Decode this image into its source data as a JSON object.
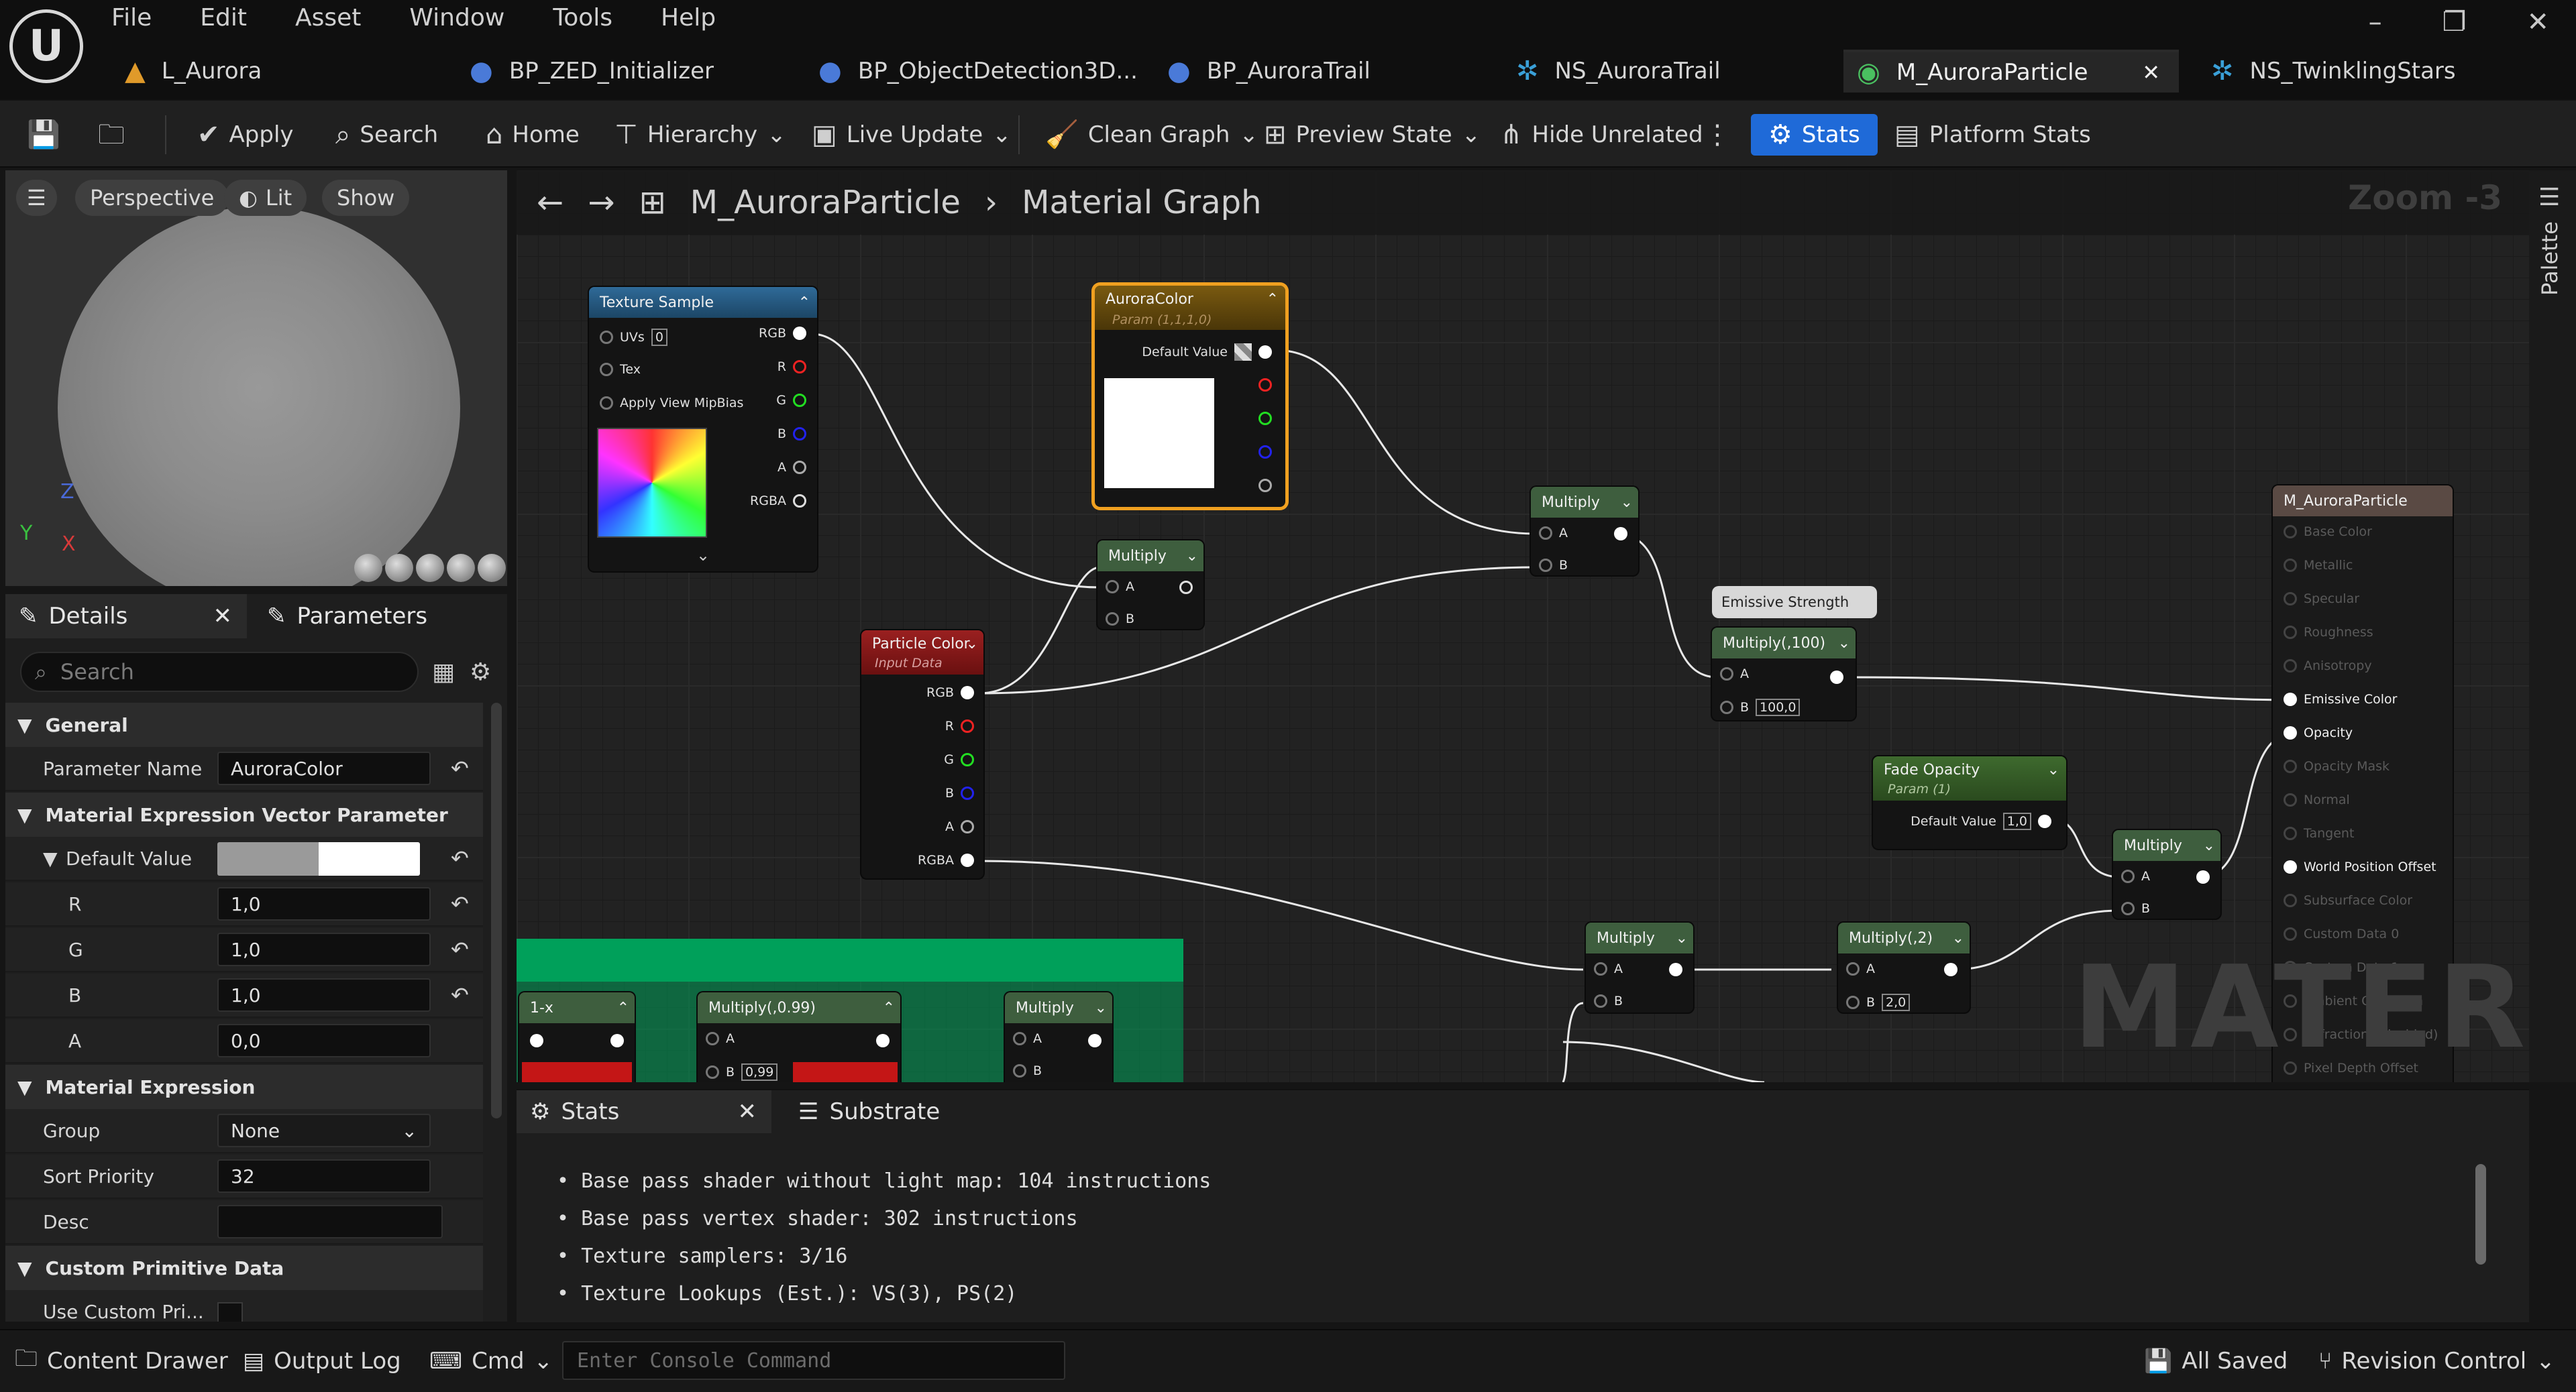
{
  "menu": [
    "File",
    "Edit",
    "Asset",
    "Window",
    "Tools",
    "Help"
  ],
  "window_controls": {
    "minimize": "–",
    "maximize": "❐",
    "close": "✕"
  },
  "tabs": [
    {
      "label": "L_Aurora",
      "icon": "level-icon"
    },
    {
      "label": "BP_ZED_Initializer",
      "icon": "blueprint-icon"
    },
    {
      "label": "BP_ObjectDetection3D...",
      "icon": "blueprint-icon"
    },
    {
      "label": "BP_AuroraTrail",
      "icon": "blueprint-icon"
    },
    {
      "label": "NS_AuroraTrail",
      "icon": "niagara-icon"
    },
    {
      "label": "M_AuroraParticle",
      "icon": "material-icon",
      "active": true
    },
    {
      "label": "NS_TwinklingStars",
      "icon": "niagara-icon"
    }
  ],
  "toolbar": {
    "apply": "Apply",
    "search": "Search",
    "home": "Home",
    "hierarchy": "Hierarchy",
    "live_update": "Live Update",
    "clean_graph": "Clean Graph",
    "preview_state": "Preview State",
    "hide_unrelated": "Hide Unrelated",
    "stats": "Stats",
    "platform_stats": "Platform Stats"
  },
  "viewport": {
    "perspective": "Perspective",
    "lit": "Lit",
    "show": "Show",
    "axis_z": "Z",
    "axis_y": "Y",
    "axis_x": "X"
  },
  "details": {
    "tab_details": "Details",
    "tab_parameters": "Parameters",
    "search_placeholder": "Search",
    "sections": {
      "general": "General",
      "vector_param": "Material Expression Vector Parameter",
      "expression": "Material Expression",
      "custom_primitive": "Custom Primitive Data"
    },
    "parameter_name_label": "Parameter Name",
    "parameter_name": "AuroraColor",
    "default_value_label": "Default Value",
    "r_label": "R",
    "r": "1,0",
    "g_label": "G",
    "g": "1,0",
    "b_label": "B",
    "b": "1,0",
    "a_label": "A",
    "a": "0,0",
    "group_label": "Group",
    "group": "None",
    "sort_priority_label": "Sort Priority",
    "sort_priority": "32",
    "desc_label": "Desc",
    "desc": "",
    "use_custom_label": "Use Custom Pri..."
  },
  "graph": {
    "breadcrumb_asset": "M_AuroraParticle",
    "breadcrumb_graph": "Material Graph",
    "zoom": "Zoom -3",
    "watermark": "MATERIAL",
    "palette": "Palette",
    "texture_sample": {
      "title": "Texture Sample",
      "uvs": "UVs",
      "uvs_val": "0",
      "tex": "Tex",
      "mip": "Apply View MipBias",
      "rgb": "RGB",
      "r": "R",
      "g": "G",
      "b": "B",
      "a": "A",
      "rgba": "RGBA"
    },
    "aurora_color": {
      "title": "AuroraColor",
      "sub": "Param (1,1,1,0)",
      "default": "Default Value"
    },
    "multiply_1": {
      "title": "Multiply",
      "a": "A",
      "b": "B"
    },
    "particle_color": {
      "title": "Particle Color",
      "sub": "Input Data",
      "rgb": "RGB",
      "r": "R",
      "g": "G",
      "b": "B",
      "a": "A",
      "rgba": "RGBA"
    },
    "multiply_2": {
      "title": "Multiply",
      "a": "A",
      "b": "B"
    },
    "emissive_strength": "Emissive Strength",
    "multiply_100": {
      "title": "Multiply(,100)",
      "a": "A",
      "b": "B",
      "b_val": "100,0"
    },
    "fade_opacity": {
      "title": "Fade Opacity",
      "sub": "Param (1)",
      "default": "Default Value",
      "default_val": "1,0"
    },
    "multiply_3": {
      "title": "Multiply",
      "a": "A",
      "b": "B"
    },
    "multiply_4": {
      "title": "Multiply",
      "a": "A",
      "b": "B"
    },
    "multiply_2x": {
      "title": "Multiply(,2)",
      "a": "A",
      "b": "B",
      "b_val": "2,0"
    },
    "one_minus": {
      "title": "1-x"
    },
    "multiply_099": {
      "title": "Multiply(,0.99)",
      "a": "A",
      "b": "B",
      "b_val": "0,99"
    },
    "multiply_5": {
      "title": "Multiply",
      "a": "A",
      "b": "B"
    },
    "result": {
      "title": "M_AuroraParticle",
      "pins": [
        "Base Color",
        "Metallic",
        "Specular",
        "Roughness",
        "Anisotropy",
        "Emissive Color",
        "Opacity",
        "Opacity Mask",
        "Normal",
        "Tangent",
        "World Position Offset",
        "Subsurface Color",
        "Custom Data 0",
        "Custom Data 1",
        "Ambient Occlusion",
        "Refraction (Disabled)",
        "Pixel Depth Offset"
      ],
      "active": [
        "Emissive Color",
        "Opacity",
        "World Position Offset"
      ]
    }
  },
  "stats": {
    "tab_stats": "Stats",
    "tab_substrate": "Substrate",
    "lines": [
      "Base pass shader without light map: 104 instructions",
      "Base pass vertex shader: 302 instructions",
      "Texture samplers: 3/16",
      "Texture Lookups (Est.): VS(3), PS(2)"
    ]
  },
  "statusbar": {
    "content_drawer": "Content Drawer",
    "output_log": "Output Log",
    "cmd": "Cmd",
    "console_placeholder": "Enter Console Command",
    "all_saved": "All Saved",
    "revision_control": "Revision Control"
  },
  "colors": {
    "accent": "#1f6ad8",
    "param_orange": "#f0a020",
    "comment_green": "#00a05a",
    "multiply_header": "#3e5e3e",
    "particle_header": "#8a1c1c",
    "texture_header": "#2a5a80"
  }
}
